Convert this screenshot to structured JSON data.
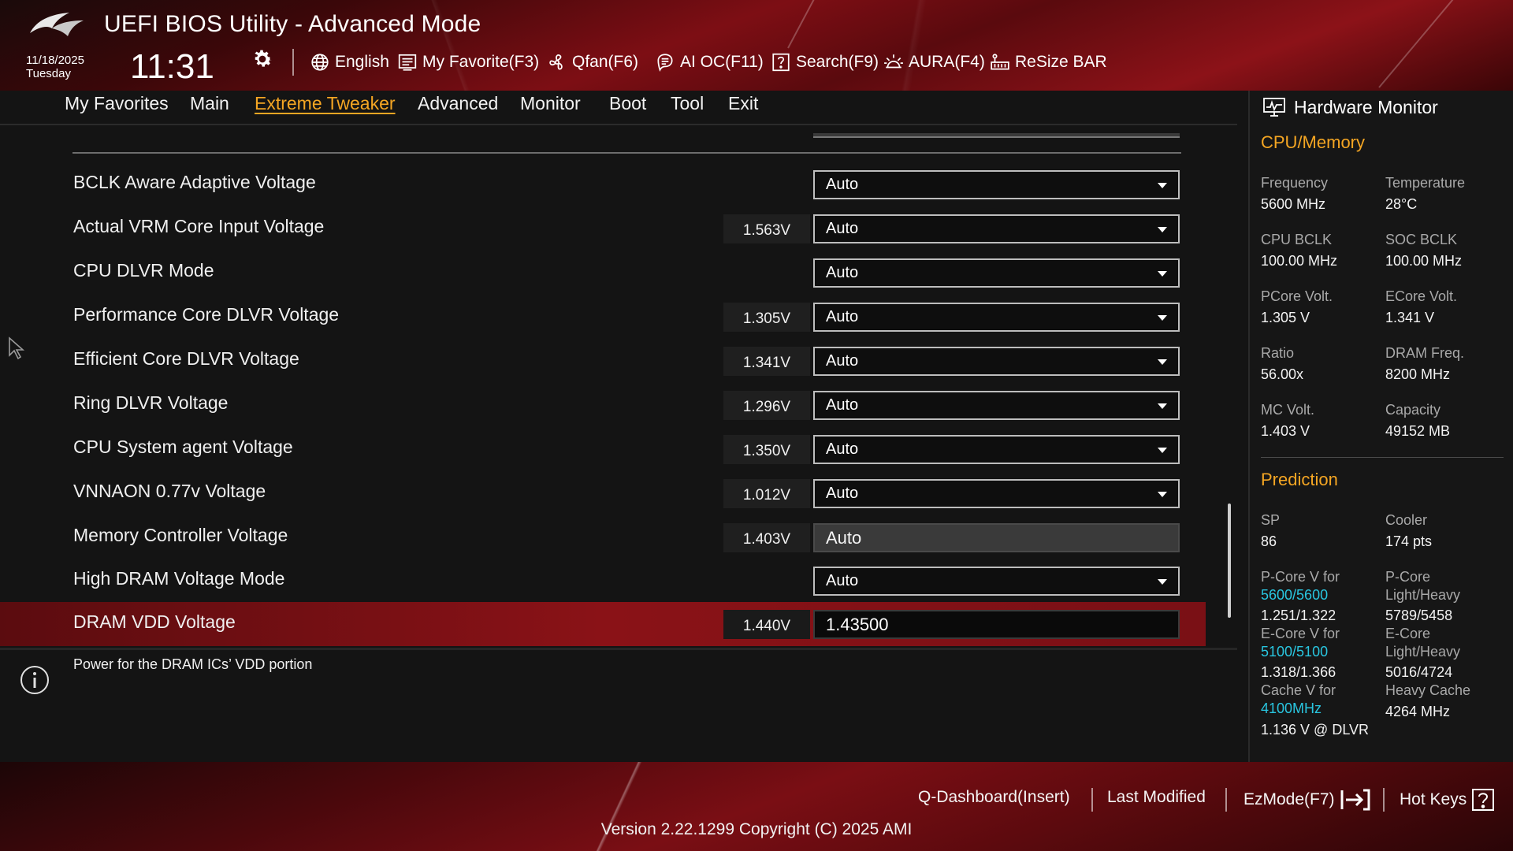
{
  "header": {
    "app_title": "UEFI BIOS Utility - Advanced Mode",
    "date": "11/18/2025",
    "weekday": "Tuesday",
    "time": "11:31",
    "tools": [
      {
        "label": "English",
        "icon": "globe-icon"
      },
      {
        "label": "My Favorite(F3)",
        "icon": "favorite-list-icon"
      },
      {
        "label": "Qfan(F6)",
        "icon": "fan-icon"
      },
      {
        "label": "AI OC(F11)",
        "icon": "ai-chip-icon"
      },
      {
        "label": "Search(F9)",
        "icon": "search-help-icon"
      },
      {
        "label": "AURA(F4)",
        "icon": "aura-light-icon"
      },
      {
        "label": "ReSize BAR",
        "icon": "resize-bar-icon"
      }
    ]
  },
  "menu": {
    "items": [
      "My Favorites",
      "Main",
      "Extreme Tweaker",
      "Advanced",
      "Monitor",
      "Boot",
      "Tool",
      "Exit"
    ],
    "active": "Extreme Tweaker"
  },
  "settings": [
    {
      "label": "BCLK Aware Adaptive Voltage",
      "value": "",
      "option": "Auto"
    },
    {
      "label": "Actual VRM Core Input Voltage",
      "value": "1.563V",
      "option": "Auto"
    },
    {
      "label": "CPU DLVR Mode",
      "value": "",
      "option": "Auto"
    },
    {
      "label": "Performance Core DLVR Voltage",
      "value": "1.305V",
      "option": "Auto"
    },
    {
      "label": "Efficient Core DLVR Voltage",
      "value": "1.341V",
      "option": "Auto"
    },
    {
      "label": "Ring DLVR Voltage",
      "value": "1.296V",
      "option": "Auto"
    },
    {
      "label": "CPU System agent Voltage",
      "value": "1.350V",
      "option": "Auto"
    },
    {
      "label": "VNNAON 0.77v Voltage",
      "value": "1.012V",
      "option": "Auto"
    },
    {
      "label": "Memory Controller Voltage",
      "value": "1.403V",
      "option": "Auto"
    },
    {
      "label": "High DRAM Voltage Mode",
      "value": "",
      "option": "Auto"
    },
    {
      "label": "DRAM VDD Voltage",
      "value": "1.440V",
      "option": "1.43500"
    }
  ],
  "help_text": "Power for the DRAM ICs’ VDD portion",
  "hardware_monitor": {
    "title": "Hardware Monitor",
    "cpu_memory": {
      "title": "CPU/Memory",
      "frequency_label": "Frequency",
      "frequency": "5600 MHz",
      "temperature_label": "Temperature",
      "temperature": "28°C",
      "cpu_bclk_label": "CPU BCLK",
      "cpu_bclk": "100.00 MHz",
      "soc_bclk_label": "SOC BCLK",
      "soc_bclk": "100.00 MHz",
      "pcore_volt_label": "PCore Volt.",
      "pcore_volt": "1.305 V",
      "ecore_volt_label": "ECore Volt.",
      "ecore_volt": "1.341 V",
      "ratio_label": "Ratio",
      "ratio": "56.00x",
      "dram_freq_label": "DRAM Freq.",
      "dram_freq": "8200 MHz",
      "mc_volt_label": "MC Volt.",
      "mc_volt": "1.403 V",
      "capacity_label": "Capacity",
      "capacity": "49152 MB"
    },
    "prediction": {
      "title": "Prediction",
      "sp_label": "SP",
      "sp": "86",
      "cooler_label": "Cooler",
      "cooler": "174 pts",
      "pcore_v_label": "P-Core V for",
      "pcore_v_freq": "5600/5600",
      "pcore_v": "1.251/1.322",
      "pcore_lh_label_1": "P-Core",
      "pcore_lh_label_2": "Light/Heavy",
      "pcore_lh": "5789/5458",
      "ecore_v_label": "E-Core V for",
      "ecore_v_freq": "5100/5100",
      "ecore_v": "1.318/1.366",
      "ecore_lh_label_1": "E-Core",
      "ecore_lh_label_2": "Light/Heavy",
      "ecore_lh": "5016/4724",
      "cache_v_label": "Cache V for",
      "cache_v_freq": "4100MHz",
      "cache_v": "1.136 V @ DLVR",
      "heavy_cache_label": "Heavy Cache",
      "heavy_cache": "4264 MHz"
    }
  },
  "footer": {
    "q_dashboard": "Q-Dashboard(Insert)",
    "last_modified": "Last Modified",
    "ezmode": "EzMode(F7)",
    "hot_keys": "Hot Keys",
    "version": "Version 2.22.1299 Copyright (C) 2025 AMI"
  },
  "colors": {
    "accent": "#f5a623",
    "selection": "#8a1217",
    "cyan": "#29c6e0"
  }
}
